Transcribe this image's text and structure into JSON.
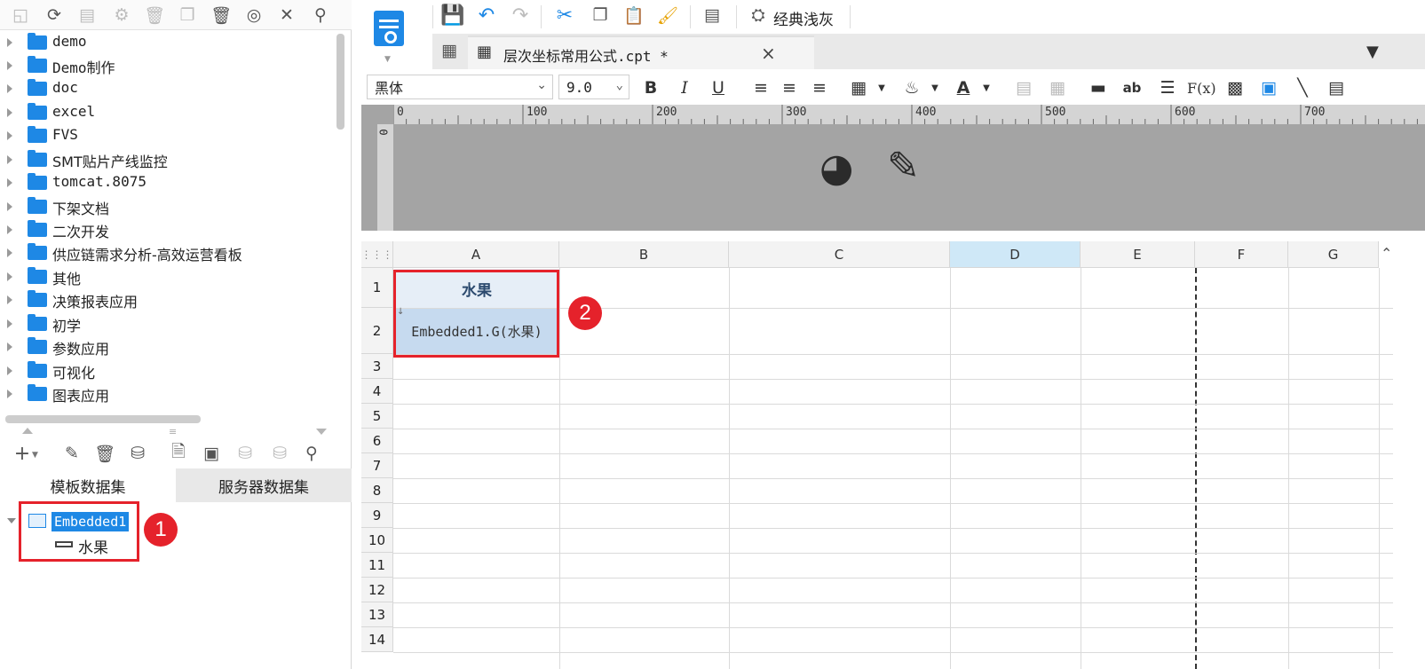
{
  "left_panel": {
    "tree_items": [
      {
        "label": "demo"
      },
      {
        "label": "Demo制作"
      },
      {
        "label": "doc"
      },
      {
        "label": "excel"
      },
      {
        "label": "FVS"
      },
      {
        "label": "SMT贴片产线监控"
      },
      {
        "label": "tomcat.8075"
      },
      {
        "label": "下架文档"
      },
      {
        "label": "二次开发"
      },
      {
        "label": "供应链需求分析-高效运营看板"
      },
      {
        "label": "其他"
      },
      {
        "label": "决策报表应用"
      },
      {
        "label": "初学"
      },
      {
        "label": "参数应用"
      },
      {
        "label": "可视化"
      },
      {
        "label": "图表应用"
      }
    ],
    "dataset_tabs": {
      "template": "模板数据集",
      "server": "服务器数据集"
    },
    "dataset": {
      "name": "Embedded1",
      "field": "水果"
    },
    "annotation_1": "1"
  },
  "toolbar": {
    "theme_label": "经典浅灰"
  },
  "tab": {
    "title": "层次坐标常用公式.cpt *",
    "close": "×"
  },
  "format": {
    "font": "黑体",
    "size": "9.0",
    "bold": "B",
    "italic": "I",
    "underline": "U",
    "fx": "F(x)",
    "ab": "ab"
  },
  "ruler": {
    "ticks": [
      "0",
      "100",
      "200",
      "300",
      "400",
      "500",
      "600",
      "700"
    ],
    "v_tick": "0"
  },
  "sheet": {
    "columns": [
      "A",
      "B",
      "C",
      "D",
      "E",
      "F",
      "G"
    ],
    "rows": [
      "1",
      "2",
      "3",
      "4",
      "5",
      "6",
      "7",
      "8",
      "9",
      "10",
      "11",
      "12",
      "13",
      "14"
    ],
    "cell_a1": "水果",
    "cell_a2": "Embedded1.G(水果)",
    "annotation_2": "2"
  },
  "colors": {
    "accent": "#1e88e5",
    "annotation": "#e5222b",
    "selected_header": "#cfe8f7",
    "cell_fill": "#c6daef"
  }
}
